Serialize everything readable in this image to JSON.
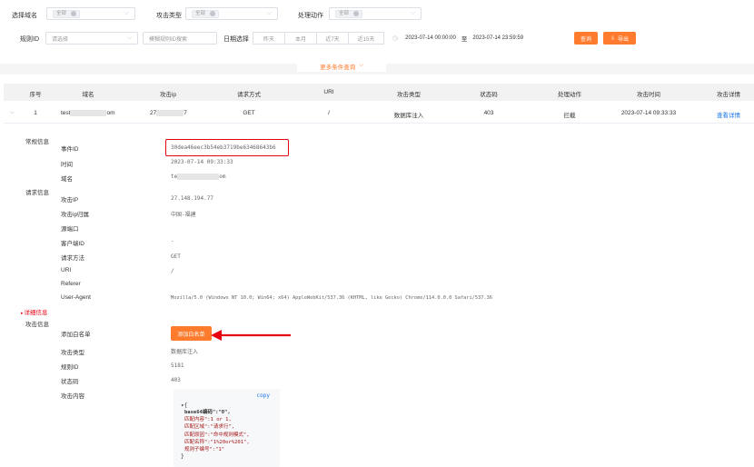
{
  "filters": {
    "domain": {
      "label": "选择域名",
      "tag": "全部"
    },
    "attack_type": {
      "label": "攻击类型",
      "tag": "全部"
    },
    "action": {
      "label": "处理动作",
      "tag": "全部"
    },
    "rule_id": {
      "label": "规则ID",
      "placeholder": "请选择"
    },
    "keyword": {
      "placeholder": "模糊规则ID搜索"
    },
    "date_label": "日期选择",
    "date_ranges": [
      "昨天",
      "本月",
      "近7天",
      "近15天"
    ],
    "start_time": "2023-07-14 00:00:00",
    "to": "至",
    "end_time": "2023-07-14 23:59:59",
    "query": "查询",
    "export": "导出",
    "more": "更多条件查询"
  },
  "table": {
    "headers": [
      "序号",
      "域名",
      "攻击ip",
      "请求方式",
      "URI",
      "攻击类型",
      "状态码",
      "处理动作",
      "攻击时间",
      "攻击详情"
    ],
    "row": {
      "index": "1",
      "domain_prefix": "test",
      "domain_suffix": "om",
      "ip_prefix": "27",
      "ip_suffix": "7",
      "method": "GET",
      "uri": "/",
      "attack_type": "数据库注入",
      "status": "403",
      "action": "拦截",
      "time": "2023-07-14 09:33:33",
      "detail": "查看详情"
    }
  },
  "detail": {
    "sec_basic": "常规信息",
    "event_id_label": "事件ID",
    "event_id": "30dea46eec3b54eb3719be63468643b6",
    "time_label": "时间",
    "time": "2023-07-14 09:33:33",
    "domain_label": "域名",
    "domain_prefix": "te",
    "domain_suffix": "om",
    "sec_request": "请求信息",
    "ip_label": "攻击IP",
    "ip": "27.148.194.77",
    "geo_label": "攻击ip归属",
    "geo": "中国-福建",
    "port_label": "源端口",
    "client_label": "客户端ID",
    "client": "-",
    "method_label": "请求方法",
    "method": "GET",
    "uri_label": "URI",
    "uri": "/",
    "referer_label": "Referer",
    "ua_label": "User-Agent",
    "ua": "Mozilla/5.0 (Windows NT 10.0; Win64; x64) AppleWebKit/537.36 (KHTML, like Gecko) Chrome/114.0.0.0 Safari/537.36",
    "more_detail": "详细信息",
    "sec_attack": "攻击信息",
    "whitelist_label": "添加白名单",
    "whitelist_btn": "添加白名单",
    "type_label": "攻击类型",
    "type": "数据库注入",
    "rule_label": "规则ID",
    "rule": "5181",
    "status_label": "状态码",
    "status": "403",
    "content_label": "攻击内容",
    "copy": "copy",
    "json_lines": [
      "base64编码\":\"0\",",
      "匹配内容\":1 or 1,",
      "匹配区域\":\"请求行\",",
      "匹配原因\":\"命中规则模式\",",
      "匹配名称\":\"1%20or%201\",",
      "规则子编号\":\"1\""
    ]
  },
  "colors": {
    "accent": "#ff7b2d",
    "highlight": "#e60012",
    "link": "#1a73e8"
  }
}
